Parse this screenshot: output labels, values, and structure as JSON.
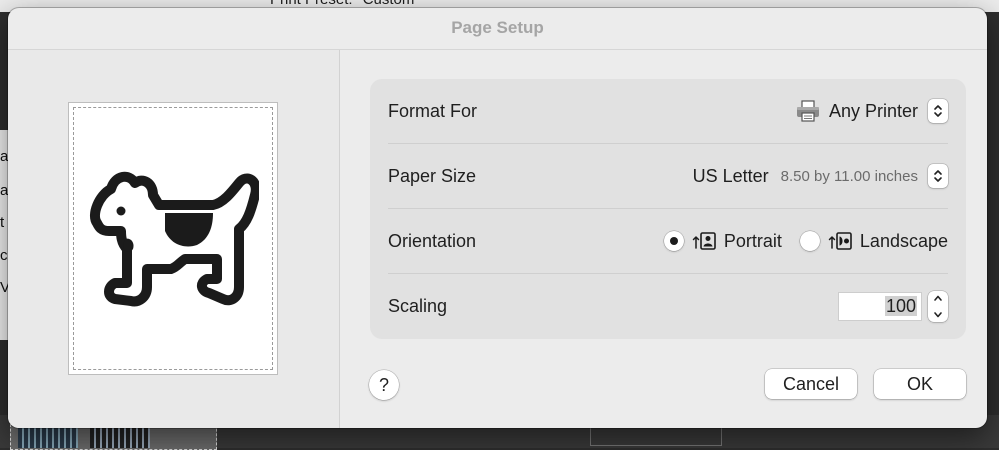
{
  "background": {
    "print_preset_label": "Print Preset:",
    "print_preset_value": "Custom",
    "side_letters": [
      "al",
      "a",
      "t",
      "c",
      "V"
    ]
  },
  "dialog": {
    "title": "Page Setup",
    "preview_icon": "dogcow-icon"
  },
  "format_for": {
    "label": "Format For",
    "value": "Any Printer",
    "icon": "printer-icon"
  },
  "paper_size": {
    "label": "Paper Size",
    "value": "US Letter",
    "dimensions": "8.50 by 11.00 inches"
  },
  "orientation": {
    "label": "Orientation",
    "options": [
      {
        "label": "Portrait",
        "selected": true,
        "icon": "portrait-orientation-icon"
      },
      {
        "label": "Landscape",
        "selected": false,
        "icon": "landscape-orientation-icon"
      }
    ]
  },
  "scaling": {
    "label": "Scaling",
    "value": "100"
  },
  "buttons": {
    "help": "?",
    "cancel": "Cancel",
    "ok": "OK"
  }
}
